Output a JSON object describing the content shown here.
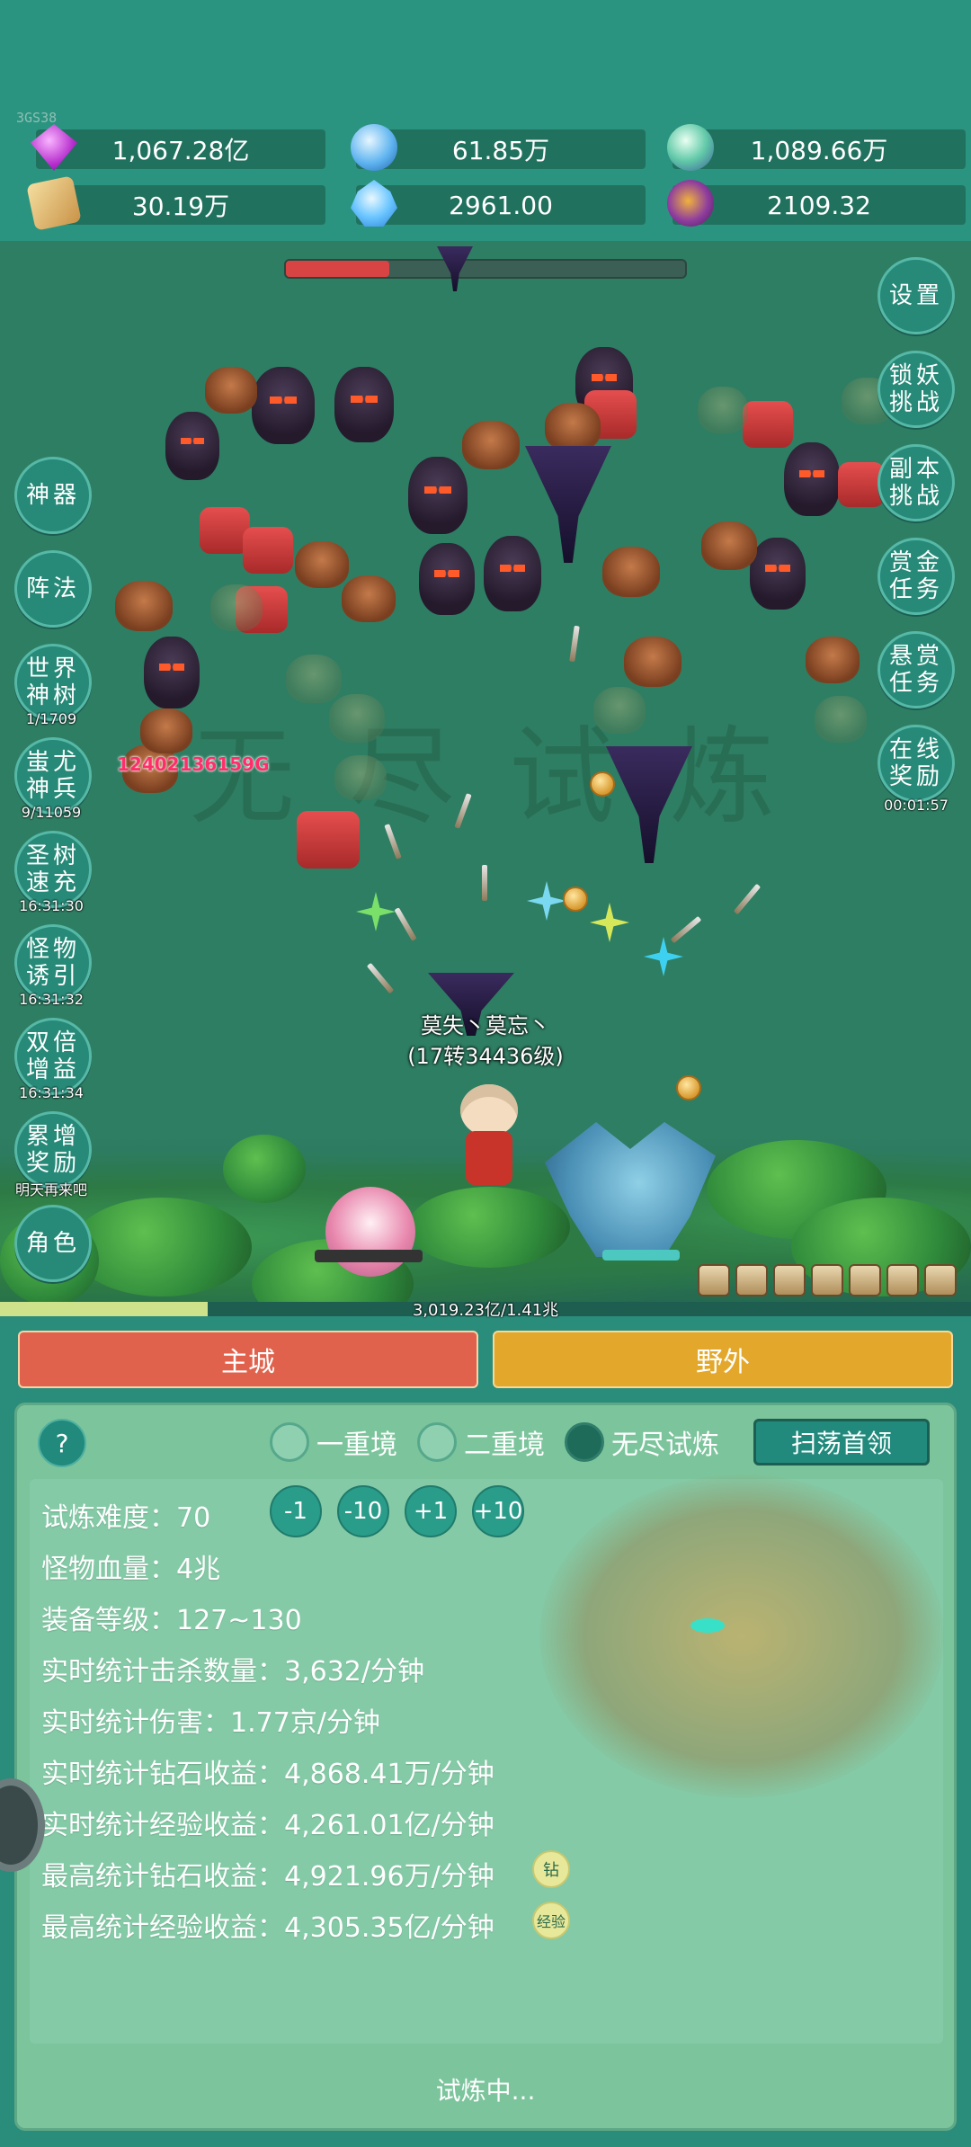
{
  "version": "3GS38",
  "resources": [
    {
      "name": "diamond-icon",
      "value": "1,067.28亿"
    },
    {
      "name": "crystal-icon",
      "value": "61.85万"
    },
    {
      "name": "orb-icon",
      "value": "1,089.66万"
    },
    {
      "name": "scroll-icon",
      "value": "30.19万"
    },
    {
      "name": "ice-crystal-icon",
      "value": "2961.00"
    },
    {
      "name": "bag-icon",
      "value": "2109.32"
    }
  ],
  "boss_hp_fraction": 0.26,
  "left_menu": [
    {
      "label": "神器",
      "sub": ""
    },
    {
      "label": "阵法",
      "sub": ""
    },
    {
      "label": "世界神树",
      "sub": "1/1709"
    },
    {
      "label": "蚩尤神兵",
      "sub": "9/11059"
    },
    {
      "label": "圣树速充",
      "sub": "16:31:30"
    },
    {
      "label": "怪物诱引",
      "sub": "16:31:32"
    },
    {
      "label": "双倍增益",
      "sub": "16:31:34"
    },
    {
      "label": "累增奖励",
      "sub": "明天再来吧"
    },
    {
      "label": "角色",
      "sub": ""
    }
  ],
  "right_menu": [
    {
      "label": "设置",
      "sub": ""
    },
    {
      "label": "锁妖挑战",
      "sub": ""
    },
    {
      "label": "副本挑战",
      "sub": ""
    },
    {
      "label": "赏金任务",
      "sub": ""
    },
    {
      "label": "悬赏任务",
      "sub": ""
    },
    {
      "label": "在线奖励",
      "sub": "00:01:57"
    }
  ],
  "damage_number": "12402136159G",
  "watermark": "无尽试炼",
  "player": {
    "name": "莫失丶莫忘丶",
    "level": "(17转34436级)"
  },
  "exp": {
    "text": "3,019.23亿/1.41兆",
    "fraction": 0.214
  },
  "tabs": {
    "city": "主城",
    "wild": "野外"
  },
  "trial": {
    "help": "?",
    "modes": [
      {
        "label": "一重境",
        "selected": false
      },
      {
        "label": "二重境",
        "selected": false
      },
      {
        "label": "无尽试炼",
        "selected": true
      }
    ],
    "sweep_button": "扫荡首领",
    "difficulty_label": "试炼难度：",
    "difficulty_value": "70",
    "adjust_buttons": [
      "-1",
      "-10",
      "+1",
      "+10"
    ],
    "stats": [
      "怪物血量：4兆",
      "装备等级：127~130",
      "实时统计击杀数量：3,632/分钟",
      "实时统计伤害：1.77京/分钟",
      "实时统计钻石收益：4,868.41万/分钟",
      "实时统计经验收益：4,261.01亿/分钟",
      "最高统计钻石收益：4,921.96万/分钟",
      "最高统计经验收益：4,305.35亿/分钟"
    ],
    "tags": [
      "钻",
      "经验"
    ],
    "status": "试炼中..."
  },
  "colors": {
    "accent": "#2a9480",
    "city_tab": "#e0624c",
    "wild_tab": "#e3a82b",
    "panel": "#7cc49c"
  }
}
